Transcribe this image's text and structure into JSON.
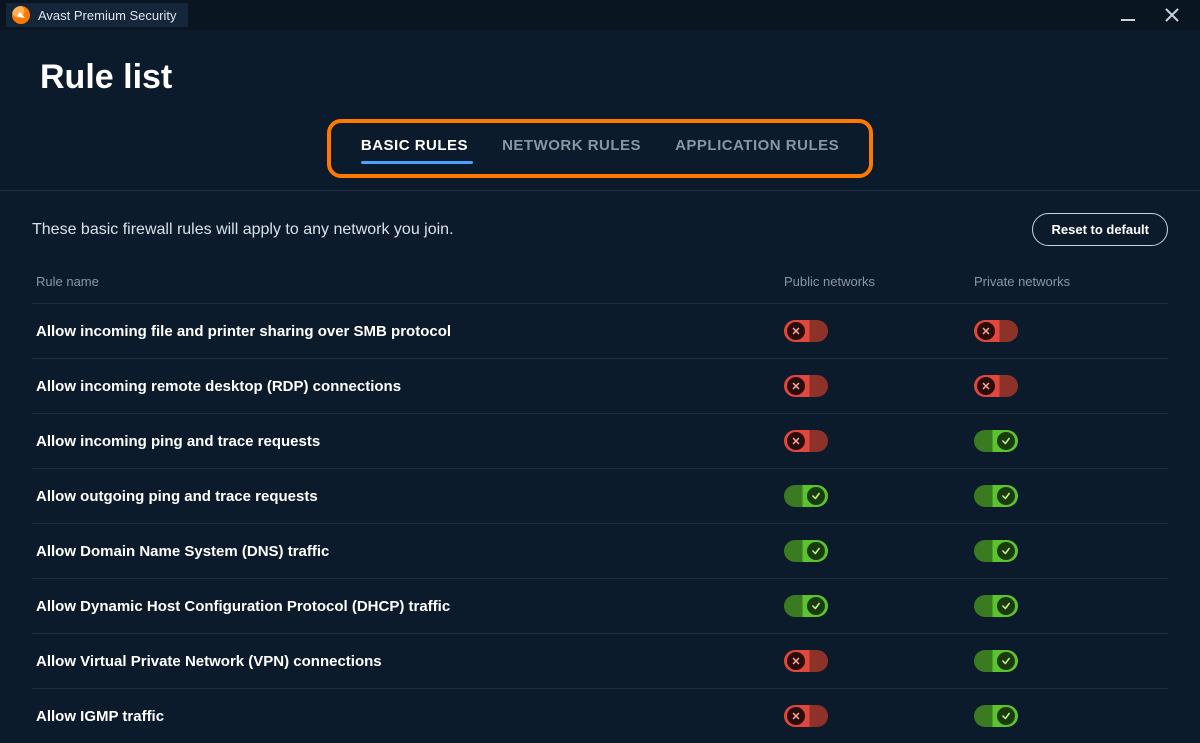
{
  "titlebar": {
    "app_name": "Avast Premium Security"
  },
  "page_title": "Rule list",
  "tabs": {
    "items": [
      {
        "label": "BASIC RULES",
        "active": true
      },
      {
        "label": "NETWORK RULES",
        "active": false
      },
      {
        "label": "APPLICATION RULES",
        "active": false
      }
    ]
  },
  "description": "These basic firewall rules will apply to any network you join.",
  "reset_label": "Reset to default",
  "columns": {
    "rule": "Rule name",
    "public": "Public networks",
    "private": "Private networks"
  },
  "rules": [
    {
      "name": "Allow incoming file and printer sharing over SMB protocol",
      "public": false,
      "private": false
    },
    {
      "name": "Allow incoming remote desktop (RDP) connections",
      "public": false,
      "private": false
    },
    {
      "name": "Allow incoming ping and trace requests",
      "public": false,
      "private": true
    },
    {
      "name": "Allow outgoing ping and trace requests",
      "public": true,
      "private": true
    },
    {
      "name": "Allow Domain Name System (DNS) traffic",
      "public": true,
      "private": true
    },
    {
      "name": "Allow Dynamic Host Configuration Protocol (DHCP) traffic",
      "public": true,
      "private": true
    },
    {
      "name": "Allow Virtual Private Network (VPN) connections",
      "public": false,
      "private": true
    },
    {
      "name": "Allow IGMP traffic",
      "public": false,
      "private": true
    }
  ]
}
